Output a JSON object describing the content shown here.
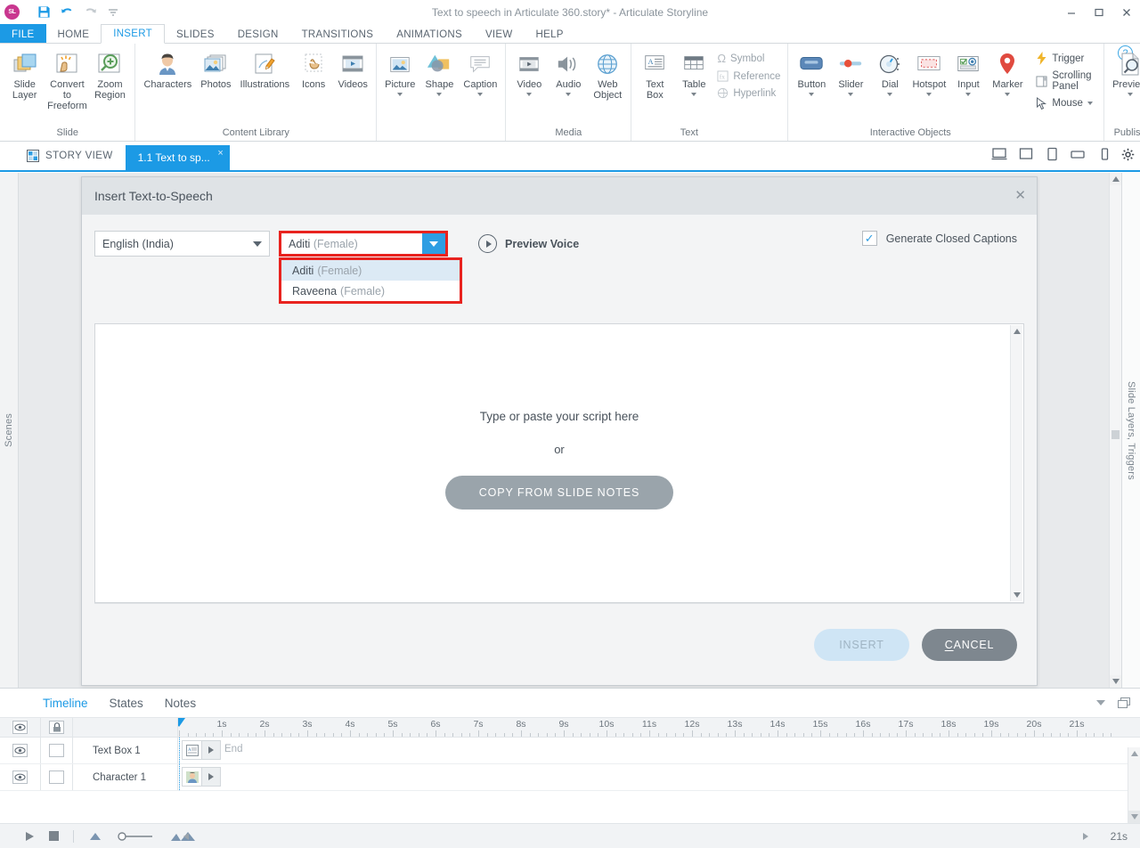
{
  "window": {
    "title": "Text to speech in Articulate 360.story* -  Articulate Storyline",
    "logo_text": "SL",
    "quick_access": [
      "save-icon",
      "undo-icon",
      "redo-icon",
      "customize-icon"
    ],
    "controls": [
      "minimize-icon",
      "maximize-icon",
      "close-icon"
    ]
  },
  "ribbon_tabs": [
    {
      "label": "FILE"
    },
    {
      "label": "HOME"
    },
    {
      "label": "INSERT"
    },
    {
      "label": "SLIDES"
    },
    {
      "label": "DESIGN"
    },
    {
      "label": "TRANSITIONS"
    },
    {
      "label": "ANIMATIONS"
    },
    {
      "label": "VIEW"
    },
    {
      "label": "HELP"
    }
  ],
  "ribbon": {
    "help_glyph": "?",
    "groups": [
      {
        "label": "Slide",
        "buttons": [
          {
            "label": "Slide Layer",
            "icon": "slide-layer-icon",
            "dropdown": false
          },
          {
            "label": "Convert to Freeform",
            "icon": "convert-freeform-icon",
            "dropdown": false
          },
          {
            "label": "Zoom Region",
            "icon": "zoom-region-icon",
            "dropdown": false
          }
        ]
      },
      {
        "label": "Content Library",
        "buttons": [
          {
            "label": "Characters",
            "icon": "characters-icon",
            "dropdown": false
          },
          {
            "label": "Photos",
            "icon": "photos-icon",
            "dropdown": false
          },
          {
            "label": "Illustrations",
            "icon": "illustrations-icon",
            "dropdown": false
          },
          {
            "label": "Icons",
            "icon": "icons-icon",
            "dropdown": false
          },
          {
            "label": "Videos",
            "icon": "videos-icon",
            "dropdown": false
          }
        ]
      },
      {
        "label": "Media",
        "buttons": [
          {
            "label": "Picture",
            "icon": "picture-icon",
            "dropdown": true
          },
          {
            "label": "Shape",
            "icon": "shape-icon",
            "dropdown": true
          },
          {
            "label": "Caption",
            "icon": "caption-icon",
            "dropdown": true
          },
          {
            "label": "Video",
            "icon": "video-icon",
            "dropdown": true
          },
          {
            "label": "Audio",
            "icon": "audio-icon",
            "dropdown": true
          },
          {
            "label": "Web Object",
            "icon": "web-object-icon",
            "dropdown": false
          }
        ]
      },
      {
        "label": "Text",
        "buttons": [
          {
            "label": "Text Box",
            "icon": "text-box-icon",
            "dropdown": false
          },
          {
            "label": "Table",
            "icon": "table-icon",
            "dropdown": true
          }
        ],
        "small_buttons": [
          {
            "label": "Symbol",
            "icon": "symbol-icon"
          },
          {
            "label": "Reference",
            "icon": "reference-icon"
          },
          {
            "label": "Hyperlink",
            "icon": "hyperlink-icon"
          }
        ]
      },
      {
        "label": "Interactive Objects",
        "buttons": [
          {
            "label": "Button",
            "icon": "button-icon",
            "dropdown": true
          },
          {
            "label": "Slider",
            "icon": "slider-icon",
            "dropdown": true
          },
          {
            "label": "Dial",
            "icon": "dial-icon",
            "dropdown": true
          },
          {
            "label": "Hotspot",
            "icon": "hotspot-icon",
            "dropdown": true
          },
          {
            "label": "Input",
            "icon": "input-icon",
            "dropdown": true
          },
          {
            "label": "Marker",
            "icon": "marker-icon",
            "dropdown": true
          }
        ],
        "small_buttons": [
          {
            "label": "Trigger",
            "icon": "trigger-icon"
          },
          {
            "label": "Scrolling Panel",
            "icon": "scrolling-panel-icon"
          },
          {
            "label": "Mouse",
            "icon": "mouse-icon"
          }
        ]
      },
      {
        "label": "Publish",
        "buttons": [
          {
            "label": "Preview",
            "icon": "preview-icon",
            "dropdown": true
          }
        ]
      }
    ]
  },
  "tabstrip": {
    "story_view": "STORY VIEW",
    "slide_tab": "1.1 Text to sp...",
    "close_glyph": "×",
    "view_icons": [
      "desktop-view-icon",
      "square-view-icon",
      "tablet-portrait-view-icon",
      "tablet-landscape-view-icon",
      "phone-view-icon",
      "gear-icon"
    ]
  },
  "rails": {
    "left": "Scenes",
    "right": "Slide Layers, Triggers"
  },
  "dialog": {
    "title": "Insert Text-to-Speech",
    "close_glyph": "✕",
    "language": {
      "value": "English (India)",
      "options": [
        "English (India)"
      ]
    },
    "voice": {
      "value_name": "Aditi",
      "value_gender": "(Female)",
      "options": [
        {
          "name": "Aditi",
          "gender": "(Female)",
          "selected": true
        },
        {
          "name": "Raveena",
          "gender": "(Female)",
          "selected": false
        }
      ]
    },
    "preview_voice_label": "Preview Voice",
    "closed_captions": {
      "label": "Generate Closed Captions",
      "checked": true,
      "check_glyph": "✓"
    },
    "script": {
      "hint": "Type or paste your script here",
      "or": "or",
      "copy_button": "COPY FROM SLIDE NOTES",
      "value": ""
    },
    "buttons": {
      "insert": "INSERT",
      "cancel_accel": "C",
      "cancel_rest": "ANCEL"
    },
    "highlight_color": "#e8231f"
  },
  "bottom_panel": {
    "tabs": [
      {
        "label": "Timeline",
        "active": true
      },
      {
        "label": "States",
        "active": false
      },
      {
        "label": "Notes",
        "active": false
      }
    ],
    "tools": [
      "collapse-icon",
      "windows-icon"
    ],
    "ruler_ticks": [
      "1s",
      "2s",
      "3s",
      "4s",
      "5s",
      "6s",
      "7s",
      "8s",
      "9s",
      "10s",
      "11s",
      "12s",
      "13s",
      "14s",
      "15s",
      "16s",
      "17s",
      "18s",
      "19s",
      "20s",
      "21s"
    ],
    "end_label": "End",
    "rows": [
      {
        "name": "Text Box 1",
        "icon": "textbox-thumb-icon",
        "eye": "eye-icon",
        "lock": "lock-checkbox"
      },
      {
        "name": "Character 1",
        "icon": "character-thumb-icon",
        "eye": "eye-icon",
        "lock": "lock-checkbox"
      }
    ],
    "header_icons": {
      "eye": "eye-icon",
      "lock": "lock-icon"
    },
    "footer_controls": [
      "play-icon",
      "stop-icon",
      "zoom-out-icon",
      "zoom-slider",
      "zoom-in-icon"
    ],
    "scroll_total": "21s"
  },
  "colors": {
    "accent": "#1c9ae5",
    "ribbon_bg": "#ffffff",
    "workspace_bg": "#e8eaec",
    "dialog_bg": "#f3f4f5",
    "highlight_red": "#e8231f"
  }
}
